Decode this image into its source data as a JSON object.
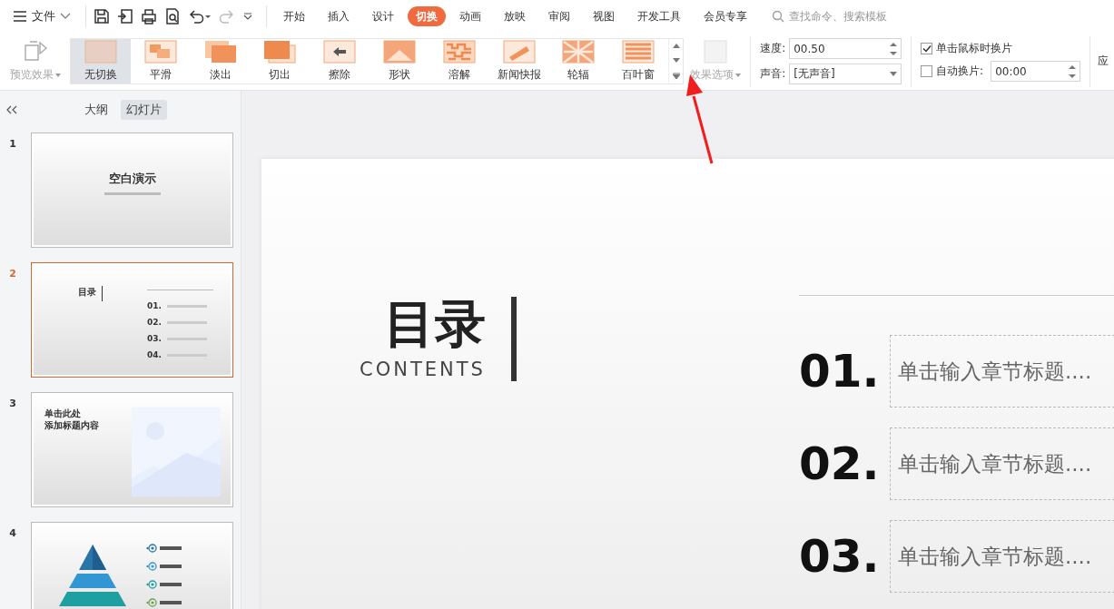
{
  "menu_bar": {
    "file_label": "文件",
    "tabs": [
      {
        "label": "开始",
        "selected": false
      },
      {
        "label": "插入",
        "selected": false
      },
      {
        "label": "设计",
        "selected": false
      },
      {
        "label": "切换",
        "selected": true
      },
      {
        "label": "动画",
        "selected": false
      },
      {
        "label": "放映",
        "selected": false
      },
      {
        "label": "审阅",
        "selected": false
      },
      {
        "label": "视图",
        "selected": false
      },
      {
        "label": "开发工具",
        "selected": false
      },
      {
        "label": "会员专享",
        "selected": false
      }
    ],
    "search": {
      "placeholder": "查找命令、搜索模板"
    }
  },
  "ribbon": {
    "preview_label": "预览效果",
    "transitions": [
      {
        "label": "无切换",
        "selected": true
      },
      {
        "label": "平滑",
        "selected": false
      },
      {
        "label": "淡出",
        "selected": false
      },
      {
        "label": "切出",
        "selected": false
      },
      {
        "label": "擦除",
        "selected": false
      },
      {
        "label": "形状",
        "selected": false
      },
      {
        "label": "溶解",
        "selected": false
      },
      {
        "label": "新闻快报",
        "selected": false
      },
      {
        "label": "轮辐",
        "selected": false
      },
      {
        "label": "百叶窗",
        "selected": false
      }
    ],
    "effect_options": "效果选项",
    "speed_label": "速度:",
    "speed_value": "00.50",
    "sound_label": "声音:",
    "sound_value": "[无声音]",
    "on_click": {
      "label": "单击鼠标时换片",
      "checked": true
    },
    "auto_advance": {
      "label": "自动换片:",
      "checked": false,
      "value": "00:00"
    },
    "cut_label": "应"
  },
  "sidebar": {
    "tabs": [
      {
        "label": "大纲",
        "selected": false
      },
      {
        "label": "幻灯片",
        "selected": true
      }
    ],
    "slides": [
      {
        "number": "1",
        "selected": false,
        "kind": "title",
        "title": "空白演示"
      },
      {
        "number": "2",
        "selected": true,
        "kind": "toc",
        "title": "目录",
        "items": [
          "01.",
          "02.",
          "03.",
          "04."
        ]
      },
      {
        "number": "3",
        "selected": false,
        "title_lines": [
          "单击此处",
          "添加标题内容"
        ]
      },
      {
        "number": "4",
        "selected": false,
        "kind": "pyramid"
      }
    ]
  },
  "slide": {
    "title": "目录",
    "subtitle": "CONTENTS",
    "items": [
      {
        "number": "01.",
        "text": "单击输入章节标题...."
      },
      {
        "number": "02.",
        "text": "单击输入章节标题...."
      },
      {
        "number": "03.",
        "text": "单击输入章节标题...."
      }
    ]
  }
}
